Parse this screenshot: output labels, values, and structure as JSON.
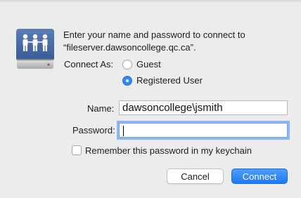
{
  "dialog": {
    "prompt_line1": "Enter your name and password to connect to",
    "prompt_line2": "“fileserver.dawsoncollege.qc.ca”.",
    "icon": "network-server-icon"
  },
  "connect_as": {
    "label": "Connect As:",
    "options": [
      {
        "label": "Guest",
        "selected": false
      },
      {
        "label": "Registered User",
        "selected": true
      }
    ]
  },
  "name_field": {
    "label": "Name:",
    "value": "dawsoncollege\\jsmith"
  },
  "password_field": {
    "label": "Password:",
    "value": ""
  },
  "remember": {
    "label": "Remember this password in my keychain",
    "checked": false
  },
  "buttons": {
    "cancel": "Cancel",
    "connect": "Connect"
  },
  "colors": {
    "accent": "#2f86f7",
    "background": "#ececec"
  }
}
